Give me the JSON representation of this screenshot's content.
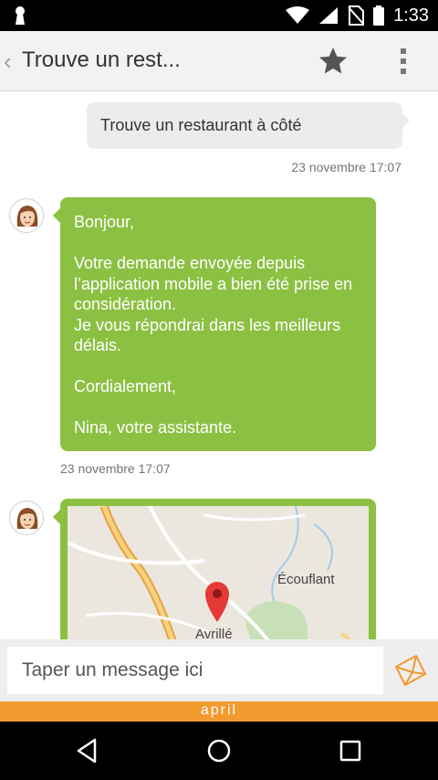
{
  "status_bar": {
    "time": "1:33",
    "icons": [
      "keyhole-icon",
      "wifi-icon",
      "signal-icon",
      "no-sim-icon",
      "battery-icon"
    ]
  },
  "action_bar": {
    "back_glyph": "‹",
    "title": "Trouve un rest...",
    "icons": [
      "star-icon",
      "overflow-menu-icon"
    ]
  },
  "messages": {
    "outgoing": {
      "text": "Trouve un restaurant à côté",
      "timestamp": "23 novembre 17:07"
    },
    "incoming": {
      "text": "Bonjour,\n\nVotre demande envoyée depuis l’application mobile a bien été prise en considération.\nJe vous répondrai dans les meilleurs délais.\n\nCordialement,\n\nNina, votre assistante.",
      "timestamp": "23 novembre 17:07"
    },
    "map": {
      "places": [
        "Écouflant",
        "Avrillé"
      ]
    }
  },
  "composer": {
    "placeholder": "Taper un message ici"
  },
  "brand": {
    "logo_text": "april"
  },
  "colors": {
    "accent_green": "#8cc043",
    "brand_orange": "#f39a2e",
    "pin_red": "#e53935"
  }
}
